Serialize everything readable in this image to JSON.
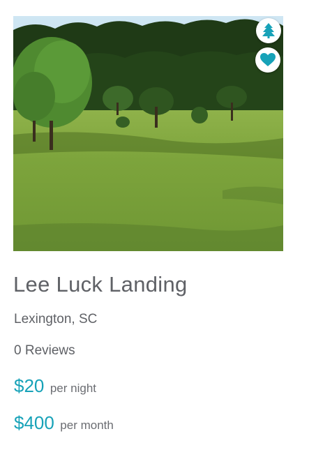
{
  "listing": {
    "title": "Lee Luck Landing",
    "location": "Lexington, SC",
    "reviews": "0 Reviews",
    "prices": [
      {
        "amount": "$20",
        "unit": "per night"
      },
      {
        "amount": "$400",
        "unit": "per month"
      }
    ]
  },
  "icons": {
    "category_icon": "tree-icon",
    "favorite_icon": "heart-icon"
  },
  "colors": {
    "accent": "#17a2b8",
    "text": "#5f6166"
  }
}
